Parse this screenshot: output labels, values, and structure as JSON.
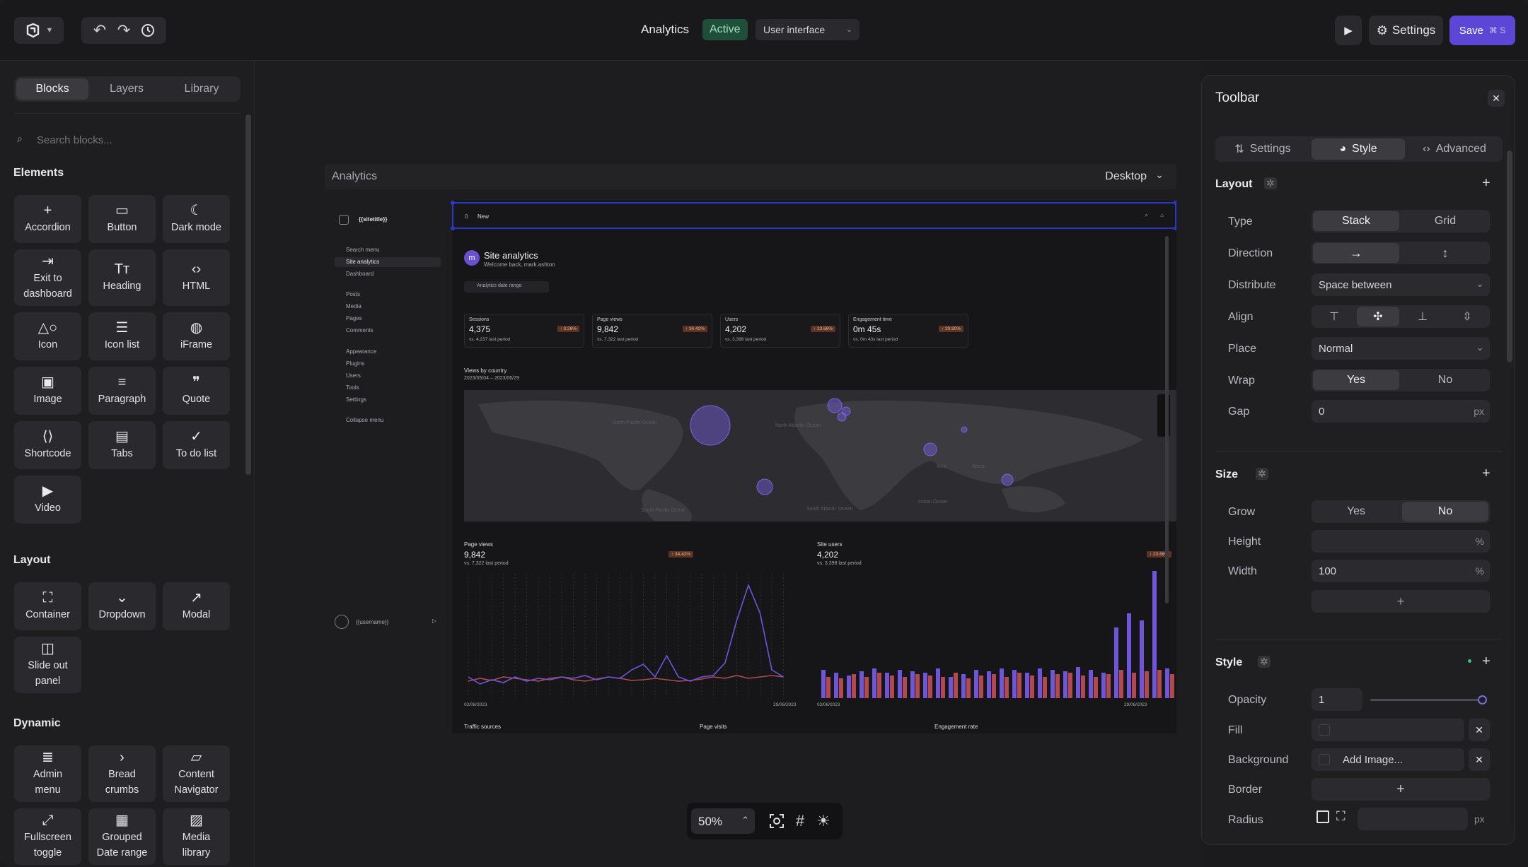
{
  "topbar": {
    "title": "Analytics",
    "status": "Active",
    "mode_select": "User interface",
    "settings_label": "Settings",
    "save_label": "Save",
    "save_shortcut": "⌘ S"
  },
  "left_panel": {
    "tabs": [
      "Blocks",
      "Layers",
      "Library"
    ],
    "search_placeholder": "Search blocks...",
    "sections": {
      "elements": "Elements",
      "layout": "Layout",
      "dynamic": "Dynamic"
    },
    "elements": [
      {
        "label": "Accordion",
        "icon": "plus-icon"
      },
      {
        "label": "Button",
        "icon": "button-icon"
      },
      {
        "label": "Dark mode",
        "icon": "moon-icon"
      },
      {
        "label": "Exit to dashboard",
        "icon": "exit-icon"
      },
      {
        "label": "Heading",
        "icon": "heading-icon"
      },
      {
        "label": "HTML",
        "icon": "code-icon"
      },
      {
        "label": "Icon",
        "icon": "shapes-icon"
      },
      {
        "label": "Icon list",
        "icon": "list-icon"
      },
      {
        "label": "iFrame",
        "icon": "globe-icon"
      },
      {
        "label": "Image",
        "icon": "image-icon"
      },
      {
        "label": "Paragraph",
        "icon": "paragraph-icon"
      },
      {
        "label": "Quote",
        "icon": "quote-icon"
      },
      {
        "label": "Shortcode",
        "icon": "shortcode-icon"
      },
      {
        "label": "Tabs",
        "icon": "tabs-icon"
      },
      {
        "label": "To do list",
        "icon": "check-circle-icon"
      },
      {
        "label": "Video",
        "icon": "play-icon"
      }
    ],
    "layout": [
      {
        "label": "Container",
        "icon": "expand-icon"
      },
      {
        "label": "Dropdown",
        "icon": "chevron-circle-icon"
      },
      {
        "label": "Modal",
        "icon": "external-icon"
      },
      {
        "label": "Slide out panel",
        "icon": "panel-icon"
      }
    ],
    "dynamic": [
      {
        "label": "Admin menu",
        "icon": "menu-icon"
      },
      {
        "label": "Bread crumbs",
        "icon": "breadcrumb-icon"
      },
      {
        "label": "Content Navigator",
        "icon": "folder-icon"
      },
      {
        "label": "Fullscreen toggle",
        "icon": "fullscreen-icon"
      },
      {
        "label": "Grouped Date range",
        "icon": "calendar-icon"
      },
      {
        "label": "Media library",
        "icon": "media-icon"
      }
    ]
  },
  "canvas": {
    "frame_title": "Analytics",
    "device": "Desktop",
    "zoom": "50%",
    "preview": {
      "site_title": "{{sitetitle}}",
      "toolbar_left": "0",
      "toolbar_new": "New",
      "nav": [
        "Search menu",
        "Site analytics",
        "Dashboard",
        "Posts",
        "Media",
        "Pages",
        "Comments",
        "Appearance",
        "Plugins",
        "Users",
        "Tools",
        "Settings",
        "Collapse menu"
      ],
      "username": "{{username}}",
      "heading": "Site analytics",
      "subheading": "Welcome back, mark.ashton",
      "date_range": "Analytics date range",
      "stats": [
        {
          "label": "Sessions",
          "value": "4,375",
          "delta": "↑ 3.26%",
          "compare": "vs. 4,237 last period"
        },
        {
          "label": "Page views",
          "value": "9,842",
          "delta": "↑ 34.42%",
          "compare": "vs. 7,322 last period"
        },
        {
          "label": "Users",
          "value": "4,202",
          "delta": "↑ 23.66%",
          "compare": "vs. 3,398 last period"
        },
        {
          "label": "Engagement time",
          "value": "0m 45s",
          "delta": "↑ 29.90%",
          "compare": "vs. 0m 43s last period"
        }
      ],
      "map_title": "Views by country",
      "map_dates": "2023/05/04 – 2023/06/29",
      "map_labels": [
        "North Pacific Ocean",
        "North Atlantic Ocean",
        "South Pacific Ocean",
        "South Atlantic Ocean",
        "Indian Ocean",
        "Asia",
        "Africa"
      ],
      "pageviews_title": "Page views",
      "pageviews_value": "9,842",
      "pageviews_delta": "↑ 34.42%",
      "pageviews_compare": "vs. 7,322 last period",
      "users_title": "Site users",
      "users_value": "4,202",
      "users_delta": "↑ 23.66%",
      "users_compare": "vs. 3,398 last period",
      "date_start": "02/06/2023",
      "date_end": "29/06/2023",
      "bottom_titles": [
        "Traffic sources",
        "Page visits",
        "Engagement rate"
      ]
    }
  },
  "right_panel": {
    "title": "Toolbar",
    "tabs": [
      "Settings",
      "Style",
      "Advanced"
    ],
    "layout": {
      "heading": "Layout",
      "type_label": "Type",
      "type_options": [
        "Stack",
        "Grid"
      ],
      "direction_label": "Direction",
      "distribute_label": "Distribute",
      "distribute_value": "Space between",
      "align_label": "Align",
      "place_label": "Place",
      "place_value": "Normal",
      "wrap_label": "Wrap",
      "wrap_options": [
        "Yes",
        "No"
      ],
      "gap_label": "Gap",
      "gap_value": "0",
      "gap_unit": "px"
    },
    "size": {
      "heading": "Size",
      "grow_label": "Grow",
      "grow_options": [
        "Yes",
        "No"
      ],
      "height_label": "Height",
      "height_unit": "%",
      "width_label": "Width",
      "width_value": "100",
      "width_unit": "%"
    },
    "style": {
      "heading": "Style",
      "opacity_label": "Opacity",
      "opacity_value": "1",
      "opacity_level": 1.0,
      "fill_label": "Fill",
      "background_label": "Background",
      "background_value": "Add Image...",
      "border_label": "Border",
      "radius_label": "Radius",
      "radius_unit": "px"
    }
  },
  "colors": {
    "accent": "#5b46d6",
    "active_badge": "#1f4f3a",
    "selection": "#2838c8",
    "chart_purple": "#6f55d9",
    "chart_red": "#b04a4e"
  }
}
